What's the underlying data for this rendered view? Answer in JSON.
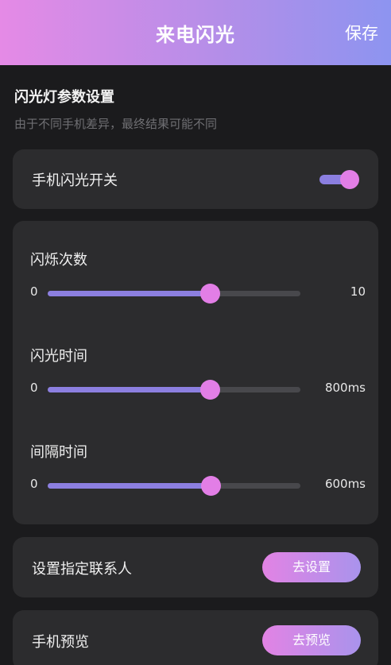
{
  "header": {
    "title": "来电闪光",
    "save_label": "保存"
  },
  "section": {
    "title": "闪光灯参数设置",
    "subtitle": "由于不同手机差异，最终结果可能不同"
  },
  "flash_switch": {
    "label": "手机闪光开关",
    "on": true
  },
  "sliders": [
    {
      "label": "闪烁次数",
      "min_label": "0",
      "max_label": "10",
      "value": 0.64
    },
    {
      "label": "闪光时间",
      "min_label": "0",
      "max_label": "800ms",
      "value": 0.64
    },
    {
      "label": "间隔时间",
      "min_label": "0",
      "max_label": "600ms",
      "value": 0.645
    }
  ],
  "contact": {
    "label": "设置指定联系人",
    "button_label": "去设置"
  },
  "preview": {
    "label": "手机预览",
    "button_label": "去预览"
  },
  "colors": {
    "accent_pink": "#e27ee6",
    "accent_purple": "#8c7fe0",
    "background": "#1b1b1d",
    "card": "#2c2c2e"
  }
}
